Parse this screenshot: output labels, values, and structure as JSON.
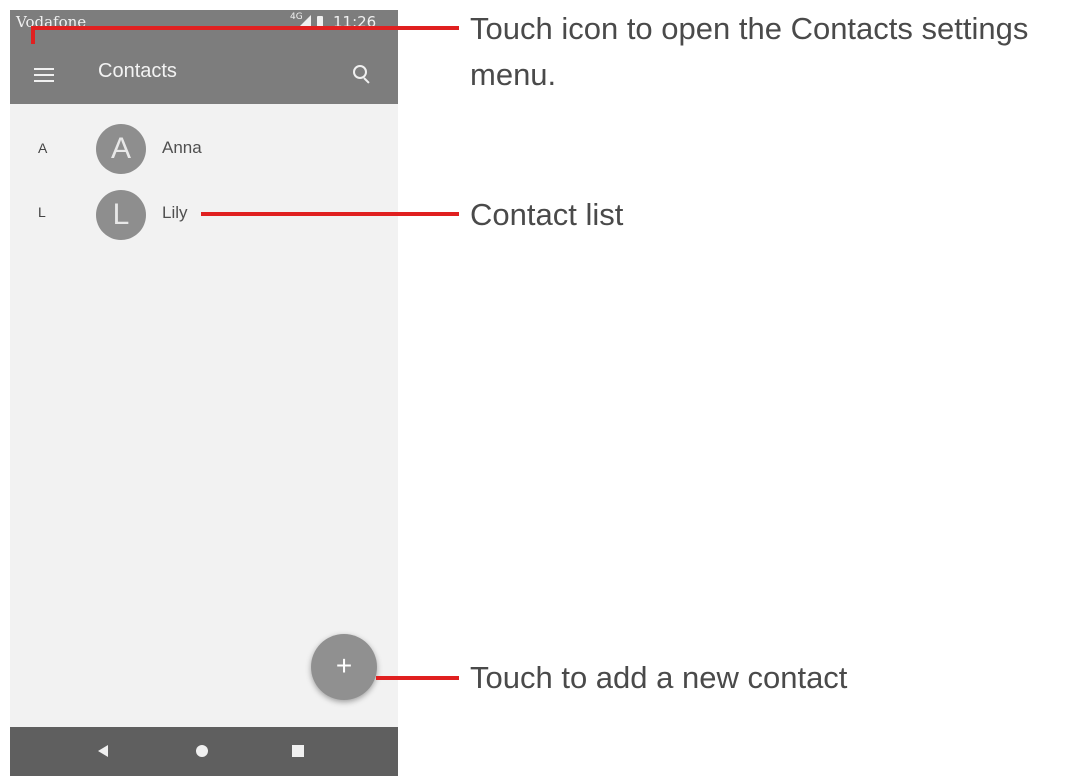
{
  "statusbar": {
    "carrier": "Vodafone",
    "network": "4G",
    "time": "11:26"
  },
  "appbar": {
    "menu_icon": "hamburger-menu-icon",
    "title": "Contacts",
    "search_icon": "search-icon"
  },
  "contacts": [
    {
      "letter": "A",
      "initial": "A",
      "name": "Anna"
    },
    {
      "letter": "L",
      "initial": "L",
      "name": "Lily"
    }
  ],
  "fab": {
    "label": "+"
  },
  "navbar": {
    "back_icon": "back-triangle-icon",
    "home_icon": "home-circle-icon",
    "recents_icon": "recents-square-icon"
  },
  "callouts": {
    "menu_line1": "Touch icon to open the Contacts settings",
    "menu_line2": "menu.",
    "list": "Contact list",
    "add": "Touch to add a new contact"
  },
  "colors": {
    "appbar": "#7d7d7d",
    "navbar": "#5f5f5f",
    "background": "#f2f2f2",
    "callout_line": "#e02020",
    "avatar": "#8e8e8e"
  }
}
